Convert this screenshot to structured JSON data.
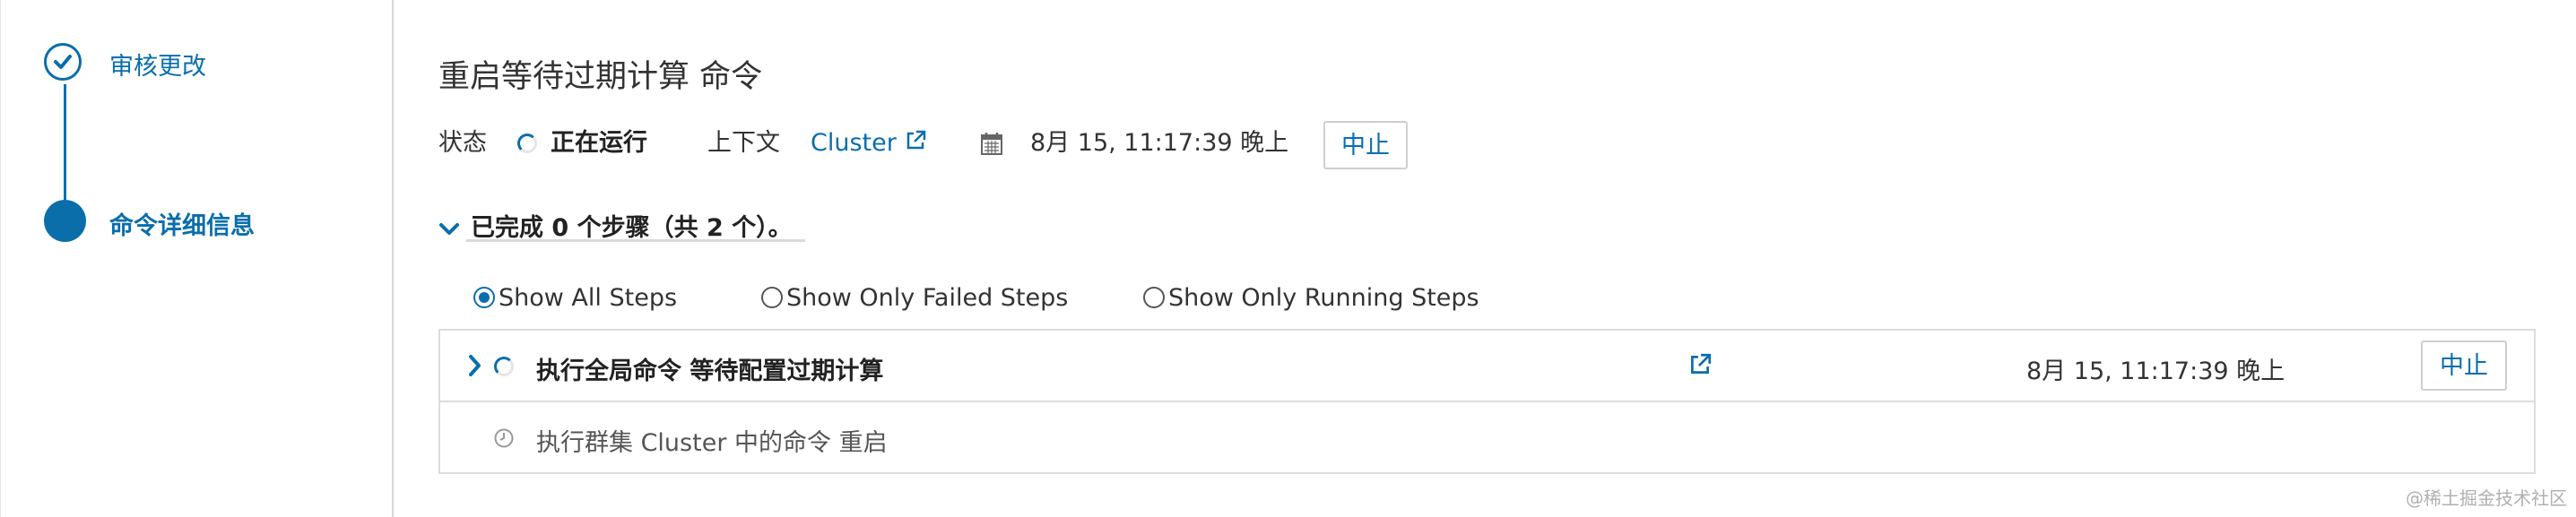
{
  "sidebar": {
    "steps": [
      {
        "label": "审核更改",
        "state": "done"
      },
      {
        "label": "命令详细信息",
        "state": "active"
      }
    ]
  },
  "main": {
    "title": "重启等待过期计算 命令",
    "status_label": "状态",
    "status_value": "正在运行",
    "context_label": "上下文",
    "context_link": "Cluster",
    "timestamp": "8月 15, 11:17:39 晚上",
    "abort_label": "中止",
    "completed_text": "已完成 0 个步骤（共 2 个）。",
    "filters": [
      {
        "label": "Show All Steps",
        "checked": true
      },
      {
        "label": "Show Only Failed Steps",
        "checked": false
      },
      {
        "label": "Show Only Running Steps",
        "checked": false
      }
    ],
    "steps": [
      {
        "name": "执行全局命令 等待配置过期计算",
        "timestamp": "8月 15, 11:17:39 晚上",
        "action": "中止"
      },
      {
        "name": "执行群集 Cluster 中的命令 重启"
      }
    ]
  },
  "colors": {
    "accent": "#0a6eab",
    "border": "#dcdcdc"
  },
  "watermark": "@稀土掘金技术社区"
}
